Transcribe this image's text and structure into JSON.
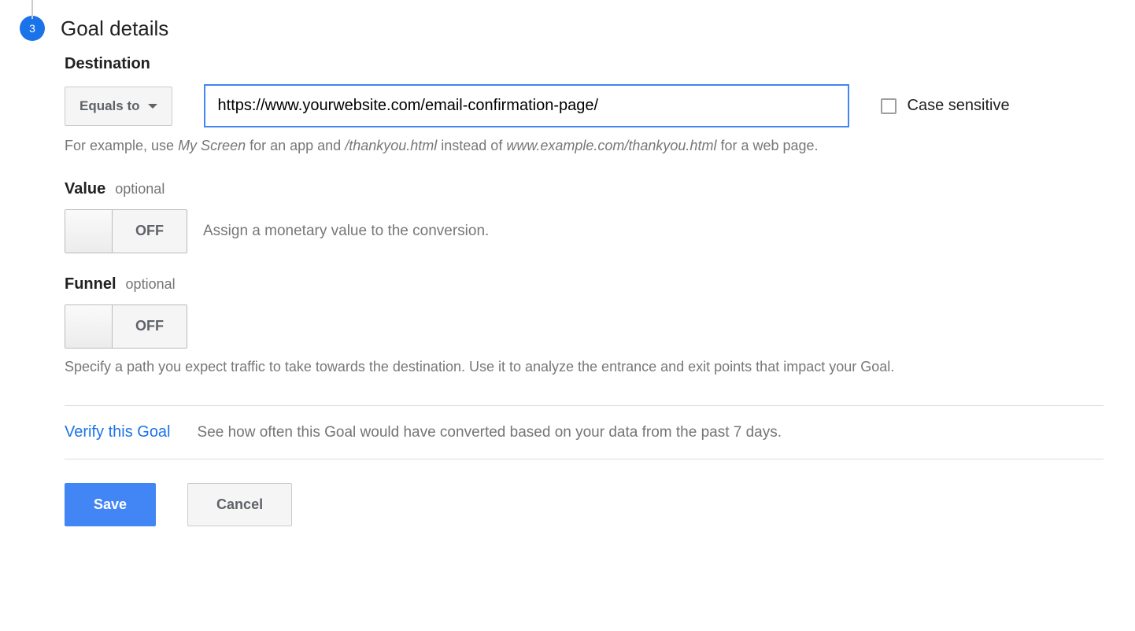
{
  "step": {
    "number": "3",
    "title": "Goal details"
  },
  "destination": {
    "title": "Destination",
    "match_type": "Equals to",
    "url_value": "https://www.yourwebsite.com/email-confirmation-page/",
    "case_sensitive_label": "Case sensitive",
    "help_prefix": "For example, use ",
    "help_example1": "My Screen",
    "help_mid1": " for an app and ",
    "help_example2": "/thankyou.html",
    "help_mid2": " instead of ",
    "help_example3": "www.example.com/thankyou.html",
    "help_suffix": " for a web page."
  },
  "value": {
    "title": "Value",
    "optional": "optional",
    "toggle_state": "OFF",
    "description": "Assign a monetary value to the conversion."
  },
  "funnel": {
    "title": "Funnel",
    "optional": "optional",
    "toggle_state": "OFF",
    "description": "Specify a path you expect traffic to take towards the destination. Use it to analyze the entrance and exit points that impact your Goal."
  },
  "verify": {
    "link": "Verify this Goal",
    "description": "See how often this Goal would have converted based on your data from the past 7 days."
  },
  "buttons": {
    "save": "Save",
    "cancel": "Cancel"
  }
}
